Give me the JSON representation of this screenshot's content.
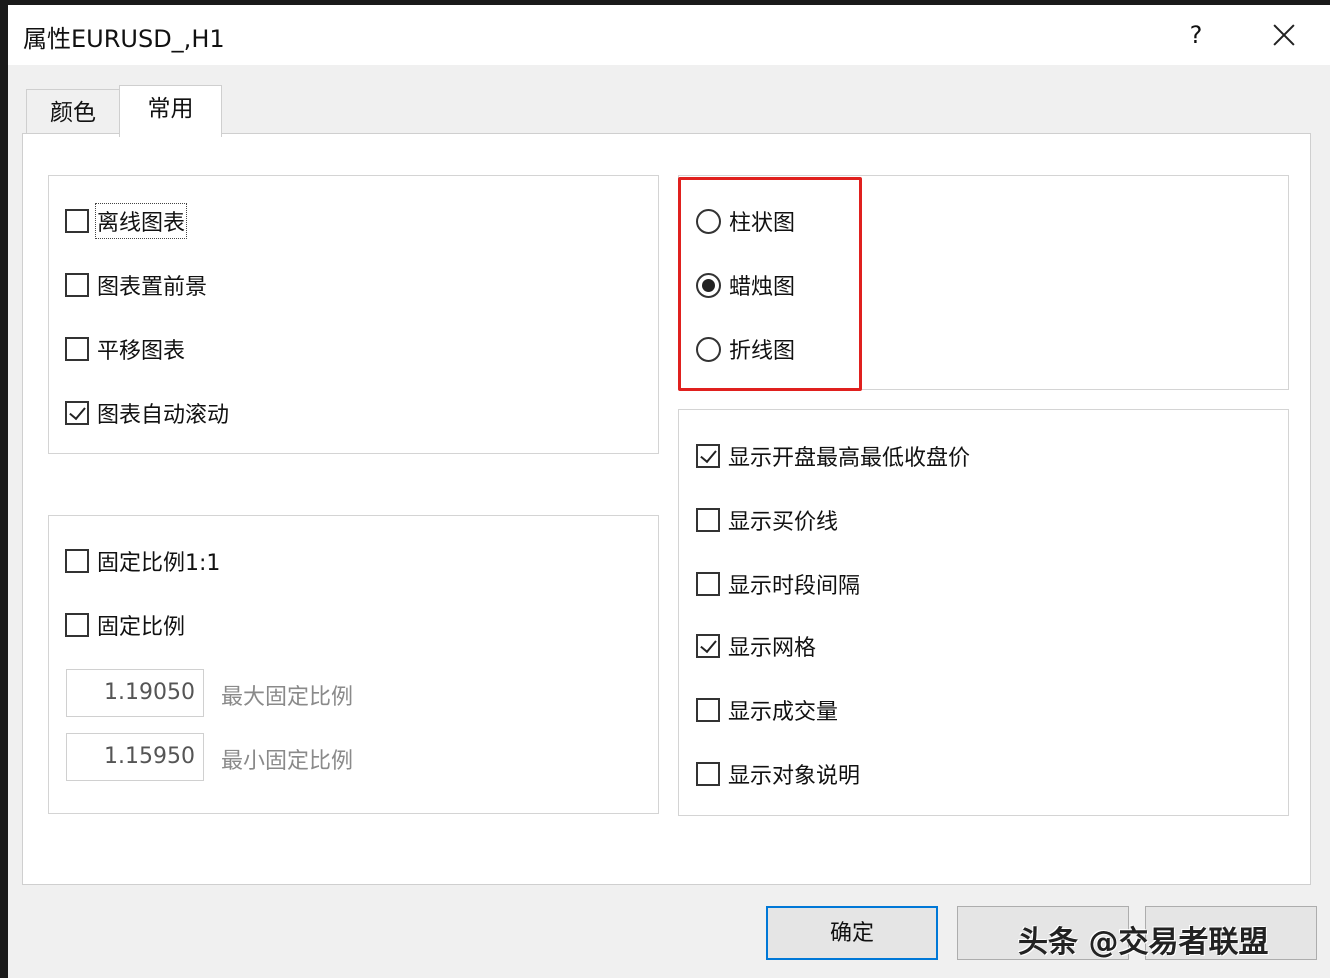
{
  "window": {
    "title": "属性EURUSD_,H1",
    "help_label": "?"
  },
  "tabs": [
    {
      "label": "颜色",
      "active": false
    },
    {
      "label": "常用",
      "active": true
    }
  ],
  "left_group_1": {
    "items": [
      {
        "label": "离线图表",
        "checked": false
      },
      {
        "label": "图表置前景",
        "checked": false
      },
      {
        "label": "平移图表",
        "checked": false
      },
      {
        "label": "图表自动滚动",
        "checked": true
      }
    ]
  },
  "left_group_2": {
    "items": [
      {
        "label": "固定比例1:1",
        "checked": false
      },
      {
        "label": "固定比例",
        "checked": false
      }
    ],
    "max_scale": {
      "value": "1.19050",
      "label": "最大固定比例"
    },
    "min_scale": {
      "value": "1.15950",
      "label": "最小固定比例"
    }
  },
  "chart_type": {
    "options": [
      {
        "label": "柱状图",
        "selected": false
      },
      {
        "label": "蜡烛图",
        "selected": true
      },
      {
        "label": "折线图",
        "selected": false
      }
    ],
    "highlight_color": "#e0201e"
  },
  "display_options": {
    "items": [
      {
        "label": "显示开盘最高最低收盘价",
        "checked": true
      },
      {
        "label": "显示买价线",
        "checked": false
      },
      {
        "label": "显示时段间隔",
        "checked": false
      },
      {
        "label": "显示网格",
        "checked": true
      },
      {
        "label": "显示成交量",
        "checked": false
      },
      {
        "label": "显示对象说明",
        "checked": false
      }
    ]
  },
  "buttons": {
    "ok": "确定",
    "watermark": "头条 @交易者联盟"
  },
  "colors": {
    "accent": "#0078d7"
  }
}
